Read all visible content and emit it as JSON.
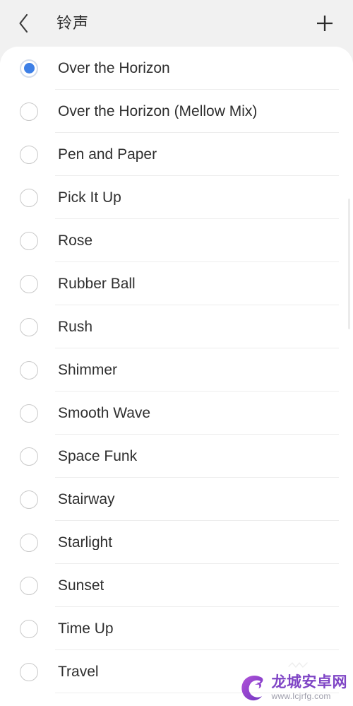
{
  "header": {
    "title": "铃声",
    "back_icon": "chevron-left-icon",
    "add_icon": "plus-icon"
  },
  "colors": {
    "background": "#f1f1f1",
    "card": "#ffffff",
    "accent": "#3d7fe6",
    "text": "#2f2f2f",
    "divider": "#ededed",
    "radio_border": "#c9c9c9",
    "watermark_purple": "#7b3fc4"
  },
  "list": {
    "selected_index": 0,
    "items": [
      {
        "label": "Over the Horizon",
        "selected": true
      },
      {
        "label": "Over the Horizon (Mellow Mix)",
        "selected": false
      },
      {
        "label": "Pen and Paper",
        "selected": false
      },
      {
        "label": "Pick It Up",
        "selected": false
      },
      {
        "label": "Rose",
        "selected": false
      },
      {
        "label": "Rubber Ball",
        "selected": false
      },
      {
        "label": "Rush",
        "selected": false
      },
      {
        "label": "Shimmer",
        "selected": false
      },
      {
        "label": "Smooth Wave",
        "selected": false
      },
      {
        "label": "Space Funk",
        "selected": false
      },
      {
        "label": "Stairway",
        "selected": false
      },
      {
        "label": "Starlight",
        "selected": false
      },
      {
        "label": "Sunset",
        "selected": false
      },
      {
        "label": "Time Up",
        "selected": false
      },
      {
        "label": "Travel",
        "selected": false
      }
    ]
  },
  "watermark": {
    "title": "龙城安卓网",
    "url": "www.lcjrfg.com"
  }
}
